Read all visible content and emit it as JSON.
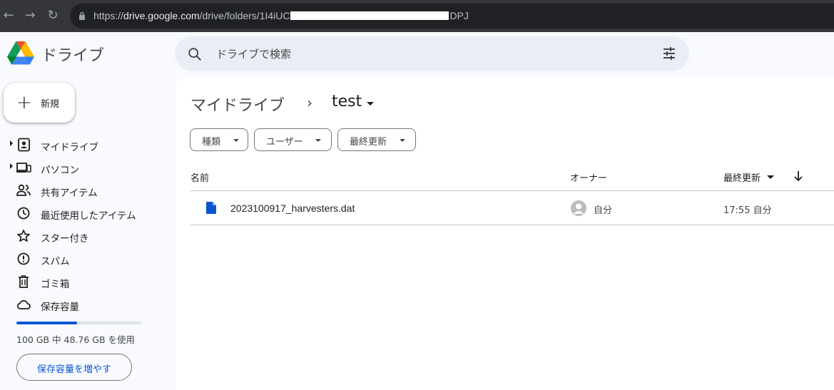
{
  "browser": {
    "url_host_prefix": "https://",
    "url_host": "drive.google.com",
    "url_path_start": "/drive/folders/1I4iUC",
    "url_path_end": "DPJ"
  },
  "app": {
    "title": "ドライブ"
  },
  "search": {
    "placeholder": "ドライブで検索"
  },
  "new_button": {
    "label": "新規"
  },
  "sidebar": {
    "items": [
      {
        "label": "マイドライブ",
        "icon": "my-drive-icon",
        "expandable": true
      },
      {
        "label": "パソコン",
        "icon": "computers-icon",
        "expandable": true
      },
      {
        "label": "共有アイテム",
        "icon": "shared-icon",
        "expandable": false
      },
      {
        "label": "最近使用したアイテム",
        "icon": "recent-icon",
        "expandable": false
      },
      {
        "label": "スター付き",
        "icon": "star-icon",
        "expandable": false
      },
      {
        "label": "スパム",
        "icon": "spam-icon",
        "expandable": false
      },
      {
        "label": "ゴミ箱",
        "icon": "trash-icon",
        "expandable": false
      },
      {
        "label": "保存容量",
        "icon": "cloud-icon",
        "expandable": false
      }
    ]
  },
  "storage": {
    "used_fraction": 0.4876,
    "text": "100 GB 中 48.76 GB を使用",
    "button_label": "保存容量を増やす"
  },
  "breadcrumb": {
    "root": "マイドライブ",
    "separator": "›",
    "current": "test"
  },
  "filters": [
    {
      "label": "種類"
    },
    {
      "label": "ユーザー"
    },
    {
      "label": "最終更新"
    }
  ],
  "table": {
    "columns": {
      "name": "名前",
      "owner": "オーナー",
      "modified": "最終更新"
    },
    "rows": [
      {
        "name": "2023100917_harvesters.dat",
        "owner": "自分",
        "modified": "17:55 自分"
      }
    ]
  },
  "colors": {
    "accent": "#0b57d0",
    "background": "#f8fafd",
    "search_bg": "#e9eef6"
  }
}
